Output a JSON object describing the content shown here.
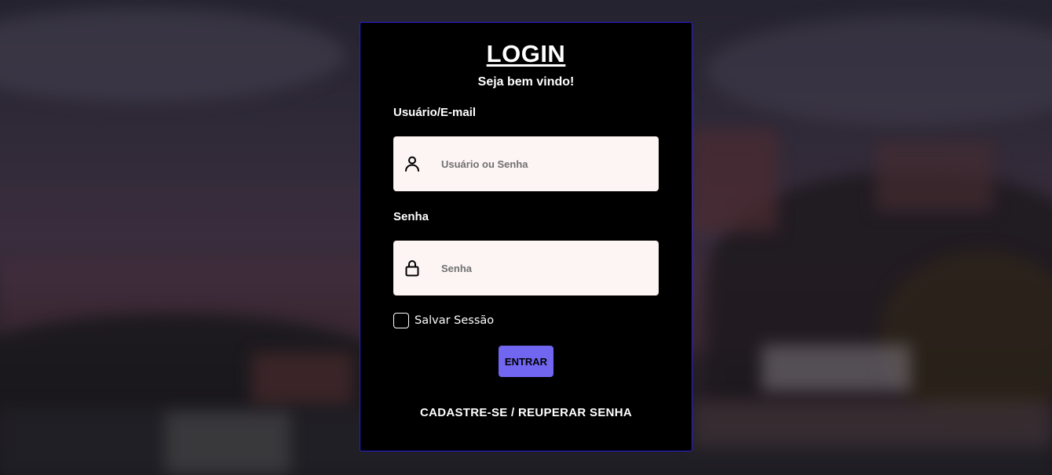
{
  "login": {
    "title": "LOGIN",
    "subtitle": "Seja bem vindo!",
    "username_label": "Usuário/E-mail",
    "username_placeholder": "Usuário ou Senha",
    "username_value": "",
    "username_icon": "user-icon",
    "password_label": "Senha",
    "password_placeholder": "Senha",
    "password_value": "",
    "password_icon": "lock-icon",
    "remember_label": "Salvar Sessão",
    "remember_checked": false,
    "submit_label": "ENTRAR",
    "signup_link": "CADASTRE-SE",
    "separator": "/",
    "recover_link": "REUPERAR SENHA"
  },
  "colors": {
    "card_background": "#000000",
    "card_border": "#2a1fd8",
    "input_background": "#fdf4f4",
    "button_background": "#7066f0",
    "text": "#ffffff"
  }
}
